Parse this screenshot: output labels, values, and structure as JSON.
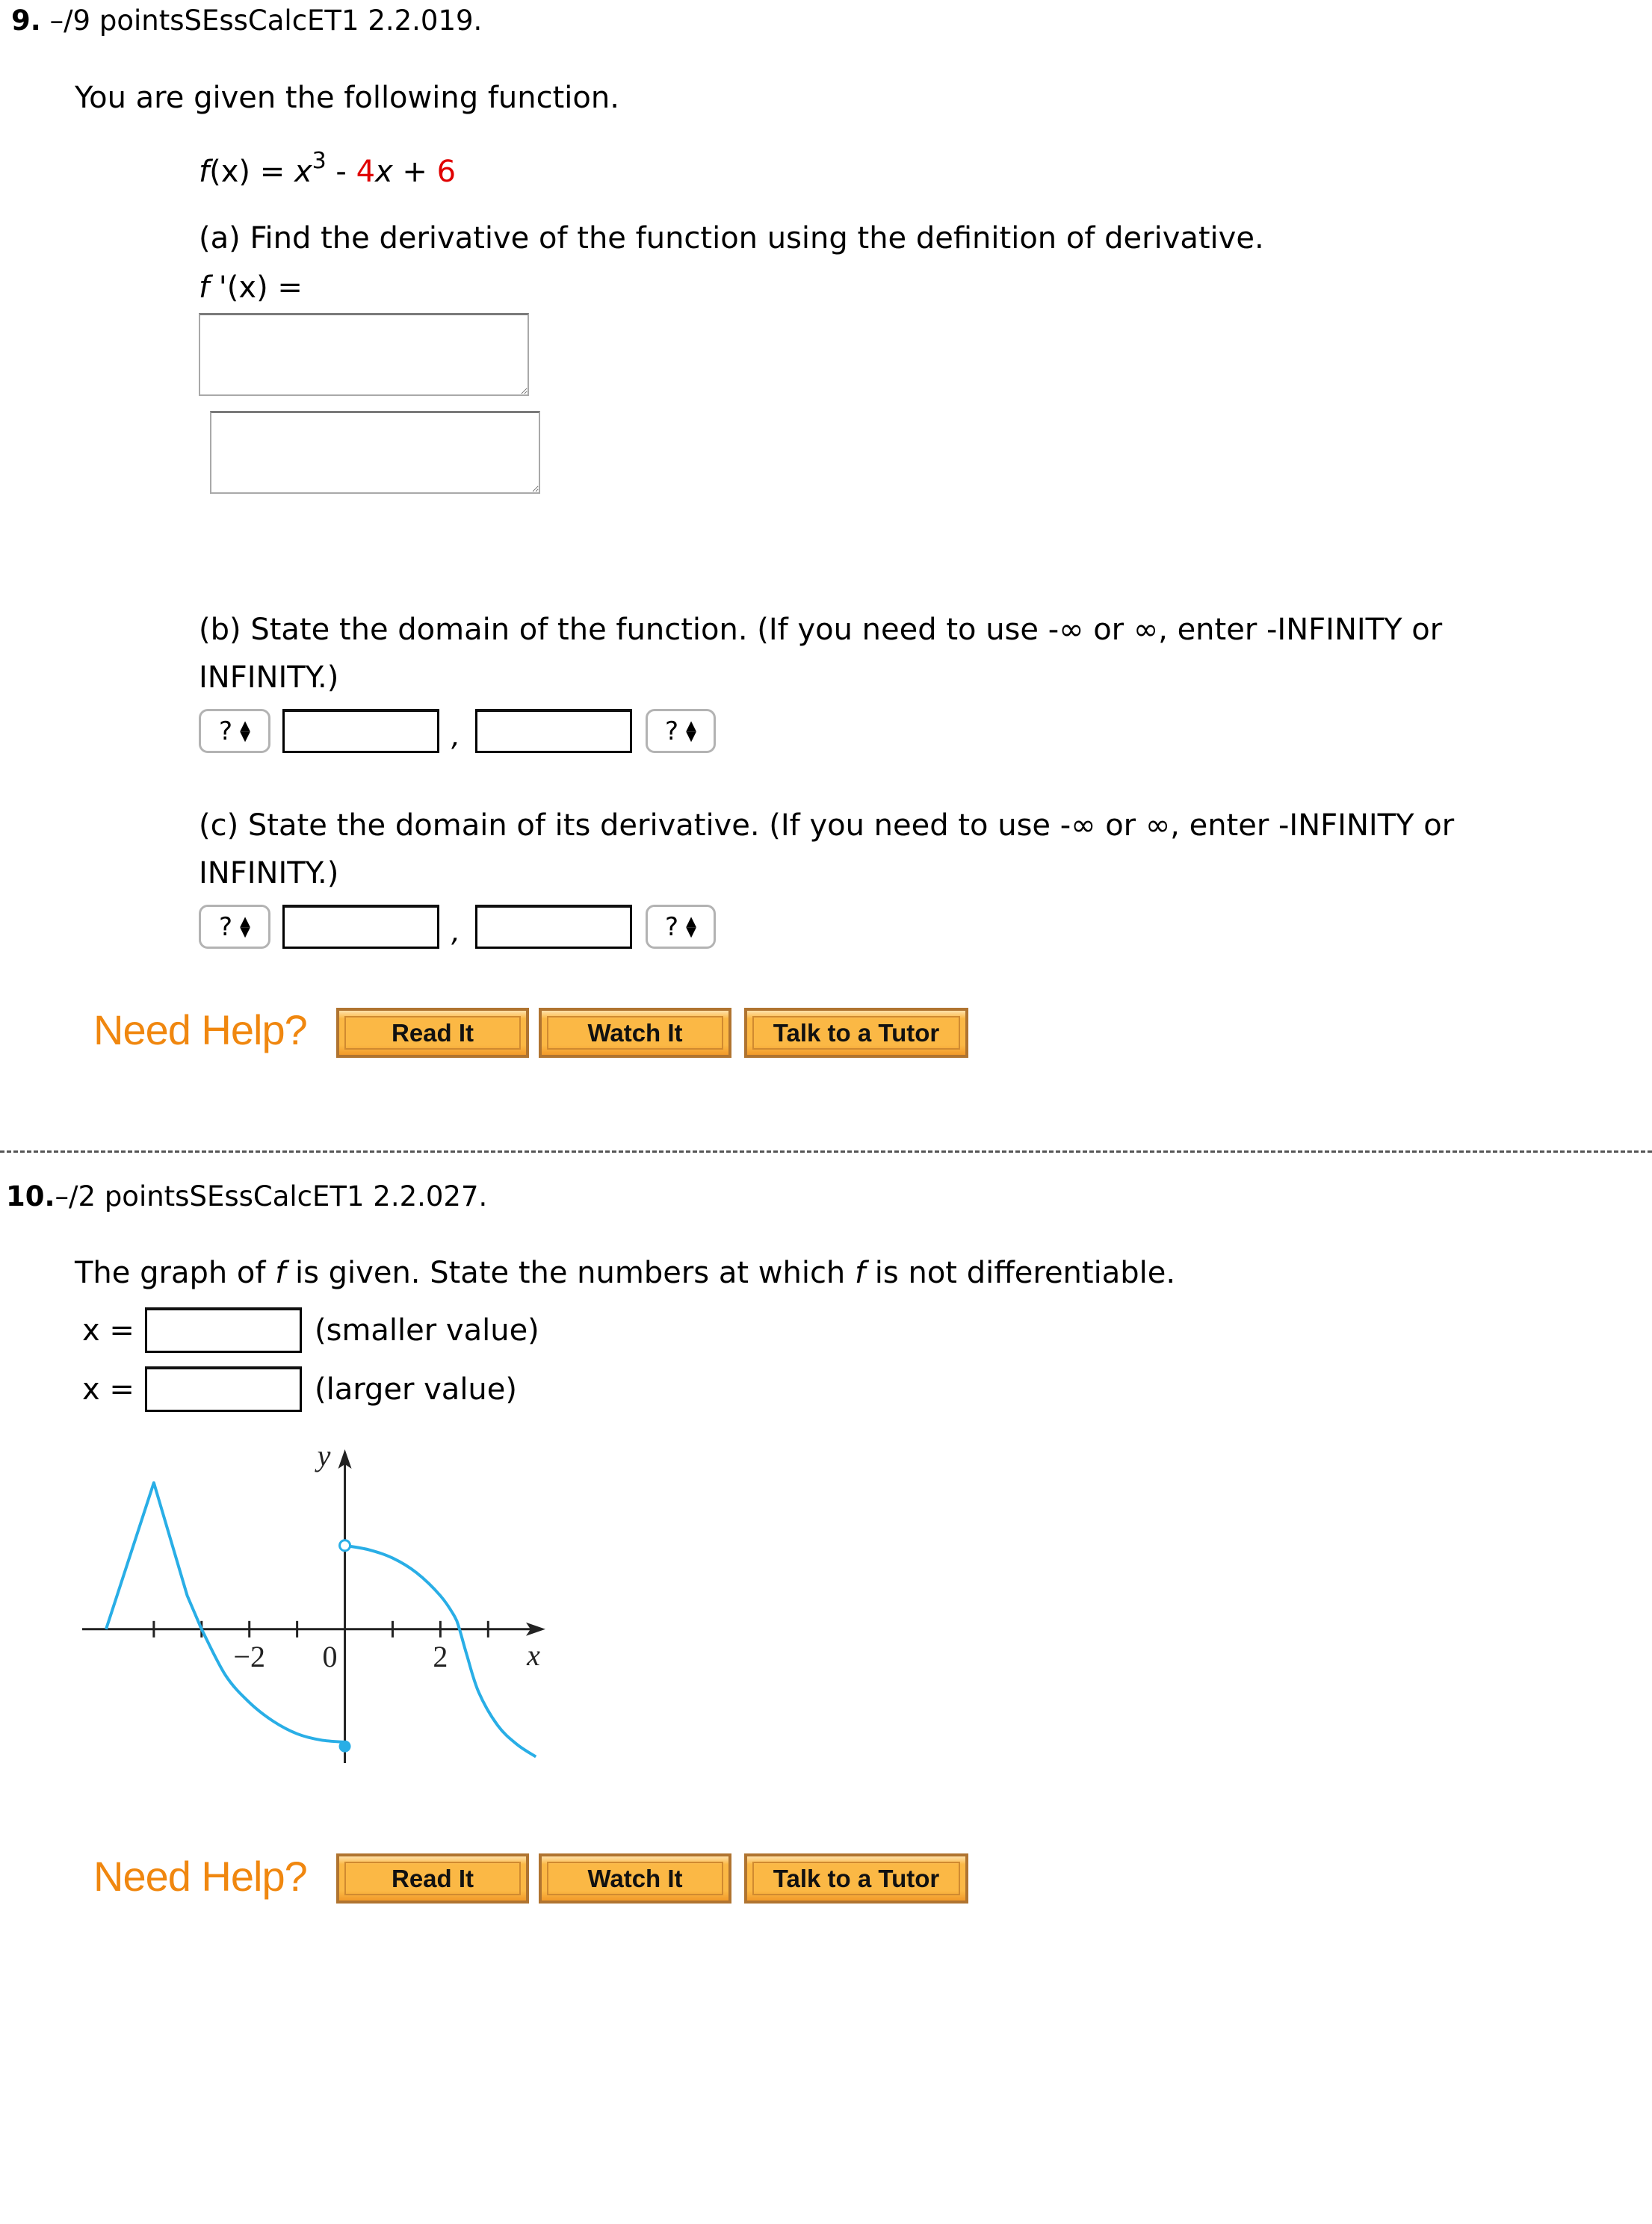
{
  "q9": {
    "number": "9.",
    "points": " –/9 points",
    "source": "SEssCalcET1 2.2.019.",
    "intro": "You are given the following function.",
    "function": {
      "lhs_f": "f",
      "lhs_x": "(x)",
      "eq": " = ",
      "x": "x",
      "exp": "3",
      "minus": " - ",
      "coef": "4",
      "x2": "x",
      "plus": " + ",
      "const": "6"
    },
    "part_a": {
      "prompt": "(a) Find the derivative of the function using the definition of derivative.",
      "label_f": "f",
      "label_rest": " '(x) =",
      "answer1": "",
      "answer2": ""
    },
    "part_b": {
      "prompt_line1": "(b) State the domain of the function. (If you need to use -∞ or ∞, enter -INFINITY or",
      "prompt_line2": "INFINITY.)",
      "left_bracket": "?",
      "lower": "",
      "comma": ",",
      "upper": "",
      "right_bracket": "?"
    },
    "part_c": {
      "prompt_line1": "(c) State the domain of its derivative. (If you need to use -∞ or ∞, enter -INFINITY or",
      "prompt_line2": "INFINITY.)",
      "left_bracket": "?",
      "lower": "",
      "comma": ",",
      "upper": "",
      "right_bracket": "?"
    },
    "help": {
      "label": "Need Help?",
      "read": "Read It",
      "watch": "Watch It",
      "tutor": "Talk to a Tutor"
    }
  },
  "q10": {
    "number": "10.",
    "points": "–/2 points",
    "source": "SEssCalcET1 2.2.027.",
    "prompt_pre": "The graph of ",
    "prompt_f1": "f",
    "prompt_mid": " is given. State the numbers at which ",
    "prompt_f2": "f",
    "prompt_post": " is not differentiable.",
    "rows": [
      {
        "label": "x =",
        "value": "",
        "hint": "(smaller value)"
      },
      {
        "label": "x =",
        "value": "",
        "hint": "(larger value)"
      }
    ],
    "graph": {
      "x_axis_label": "x",
      "y_axis_label": "y",
      "tick_labels": [
        {
          "x": -2,
          "text": "−2"
        },
        {
          "x": 0,
          "text": "0"
        },
        {
          "x": 2,
          "text": "2"
        }
      ],
      "x_ticks": [
        -4,
        -3,
        -2,
        -1,
        1,
        2,
        3
      ],
      "x_range": [
        -5.5,
        4.2
      ],
      "y_range": [
        -3.2,
        4.3
      ],
      "curve_color": "#29aee6",
      "segments": [
        {
          "name": "triangle-peak",
          "points": [
            [
              -5,
              0
            ],
            [
              -4,
              3.5
            ],
            [
              -3.3,
              0.8
            ],
            [
              -3,
              0
            ]
          ]
        },
        {
          "name": "left-decreasing-curve",
          "points": [
            [
              -3,
              0
            ],
            [
              -2.5,
              -1.1
            ],
            [
              -2,
              -1.75
            ],
            [
              -1.5,
              -2.2
            ],
            [
              -1,
              -2.5
            ],
            [
              -0.5,
              -2.65
            ],
            [
              0,
              -2.7
            ]
          ]
        },
        {
          "name": "right-decreasing-curve",
          "points": [
            [
              0,
              2
            ],
            [
              0.5,
              1.9
            ],
            [
              1,
              1.7
            ],
            [
              1.5,
              1.35
            ],
            [
              2,
              0.8
            ],
            [
              2.3,
              0.3
            ],
            [
              2.4,
              0
            ],
            [
              2.55,
              -0.6
            ],
            [
              2.8,
              -1.5
            ],
            [
              3.2,
              -2.3
            ],
            [
              3.6,
              -2.75
            ],
            [
              4.0,
              -3.05
            ]
          ]
        }
      ],
      "open_point": [
        0,
        2
      ],
      "closed_point": [
        0,
        -2.8
      ]
    },
    "help": {
      "label": "Need Help?",
      "read": "Read It",
      "watch": "Watch It",
      "tutor": "Talk to a Tutor"
    }
  }
}
